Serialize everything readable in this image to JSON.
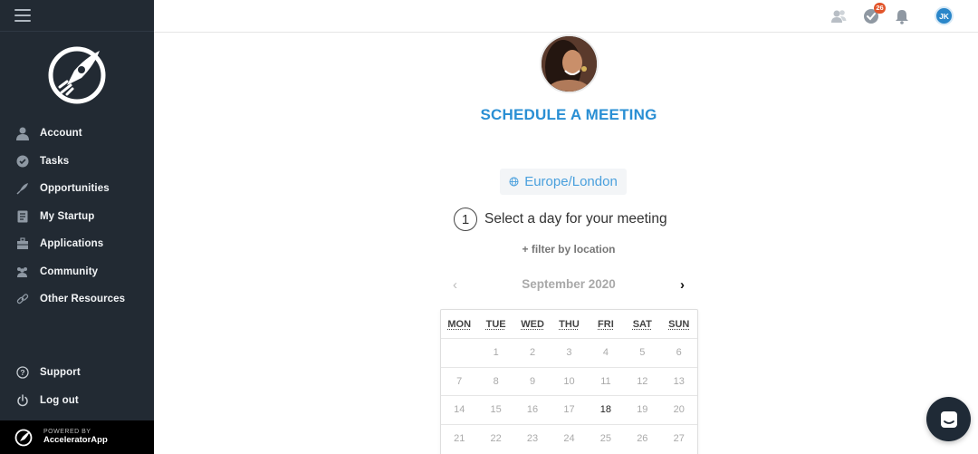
{
  "sidebar": {
    "items": [
      {
        "label": "Account",
        "icon": "person-icon"
      },
      {
        "label": "Tasks",
        "icon": "check-circle-icon"
      },
      {
        "label": "Opportunities",
        "icon": "rocket-icon"
      },
      {
        "label": "My Startup",
        "icon": "document-icon"
      },
      {
        "label": "Applications",
        "icon": "briefcase-icon"
      },
      {
        "label": "Community",
        "icon": "people-icon"
      },
      {
        "label": "Other Resources",
        "icon": "link-icon"
      }
    ],
    "bottom_items": [
      {
        "label": "Support",
        "icon": "help-icon"
      },
      {
        "label": "Log out",
        "icon": "power-icon"
      }
    ],
    "powered_by": "POWERED BY",
    "brand": "AcceleratorApp"
  },
  "topbar": {
    "tasks_badge": "26",
    "user_initials": "JK"
  },
  "main": {
    "title": "SCHEDULE A MEETING",
    "timezone": "Europe/London",
    "step_number": "1",
    "step_text": "Select a day for your meeting",
    "filter_link": "+ filter by location",
    "month": "September 2020",
    "prev_arrow": "‹",
    "next_arrow": "›"
  },
  "calendar": {
    "weekdays": [
      "MON",
      "TUE",
      "WED",
      "THU",
      "FRI",
      "SAT",
      "SUN"
    ],
    "rows": [
      [
        "",
        "1",
        "2",
        "3",
        "4",
        "5",
        "6"
      ],
      [
        "7",
        "8",
        "9",
        "10",
        "11",
        "12",
        "13"
      ],
      [
        "14",
        "15",
        "16",
        "17",
        "18",
        "19",
        "20"
      ],
      [
        "21",
        "22",
        "23",
        "24",
        "25",
        "26",
        "27"
      ]
    ],
    "highlighted": "18"
  },
  "colors": {
    "sidebar_bg": "#222a33",
    "accent_blue": "#2a8fd4",
    "badge": "#e2552b"
  }
}
